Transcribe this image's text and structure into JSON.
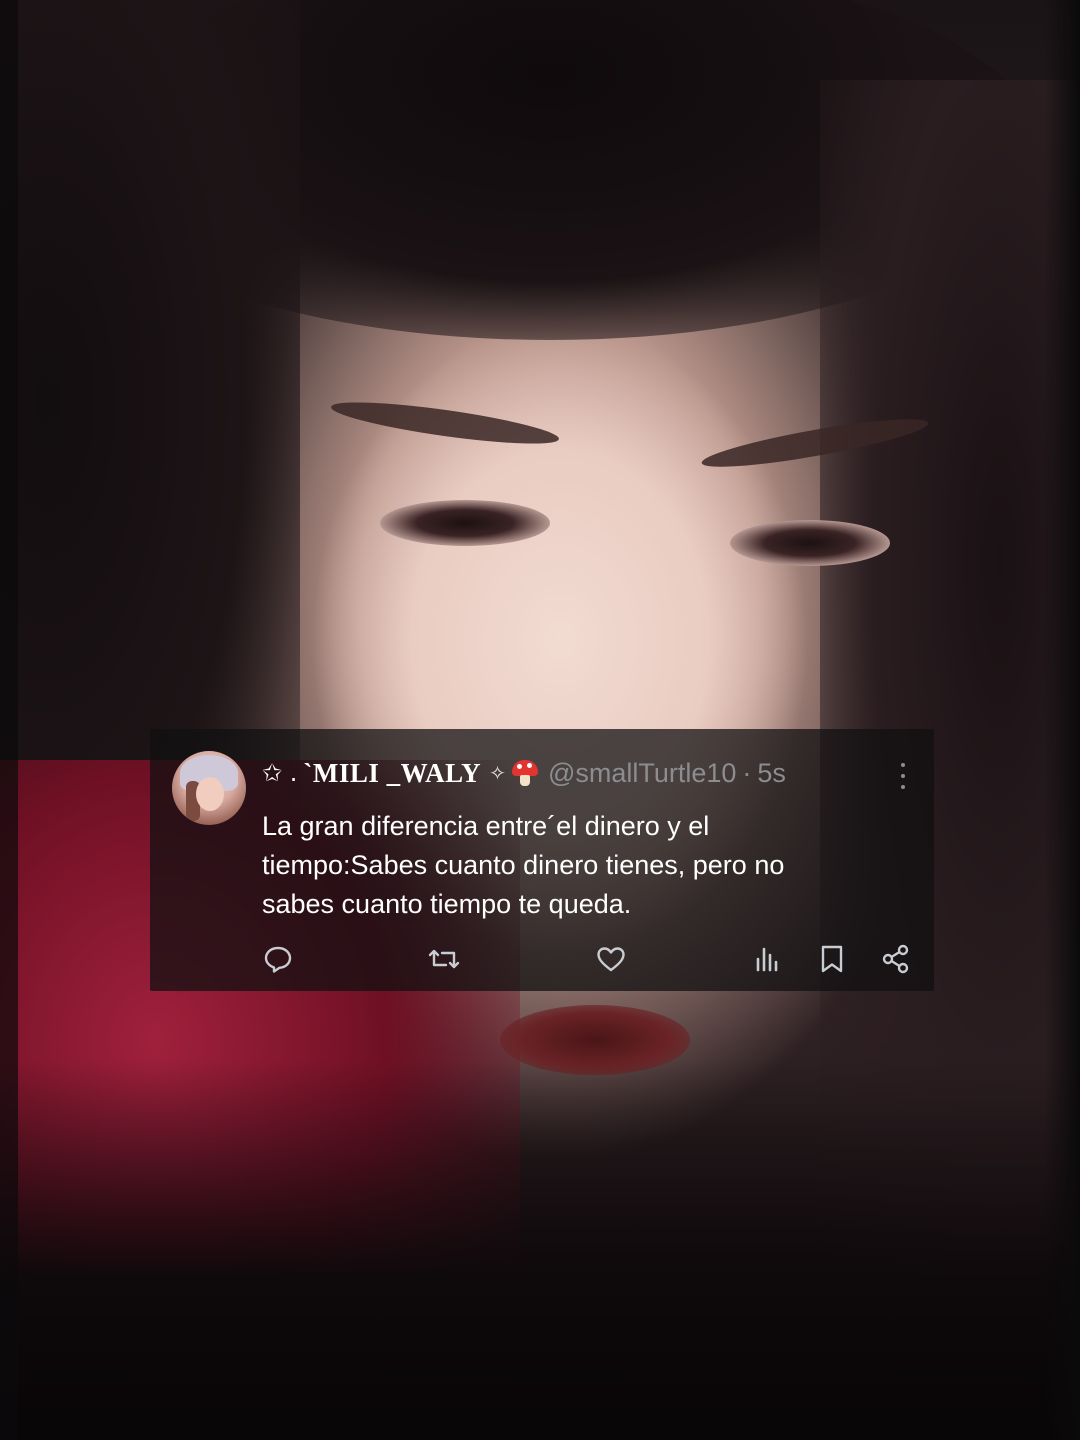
{
  "tweet": {
    "decor_prefix": "✩ .",
    "display_name": "`MILI _WALY",
    "decor_suffix": "✧",
    "handle": "@smallTurtle10",
    "separator": "·",
    "time": "5s",
    "text_lines": [
      "La gran diferencia entre´el  dinero y el",
      "tiempo:Sabes cuanto dinero tienes, pero no",
      "sabes cuanto tiempo te queda."
    ]
  },
  "icons": {
    "avatar": "avatar",
    "mushroom": "mushroom-emoji-icon",
    "more": "more-options-icon",
    "reply": "reply-icon",
    "retweet": "retweet-icon",
    "like": "heart-icon",
    "views": "views-bar-chart-icon",
    "bookmark": "bookmark-icon",
    "share": "share-icon"
  },
  "colors": {
    "text_primary": "#ffffff",
    "text_secondary": "#8b8d91",
    "card_background": "rgba(18,16,17,0.74)",
    "action_icon": "#c9ccd1"
  }
}
